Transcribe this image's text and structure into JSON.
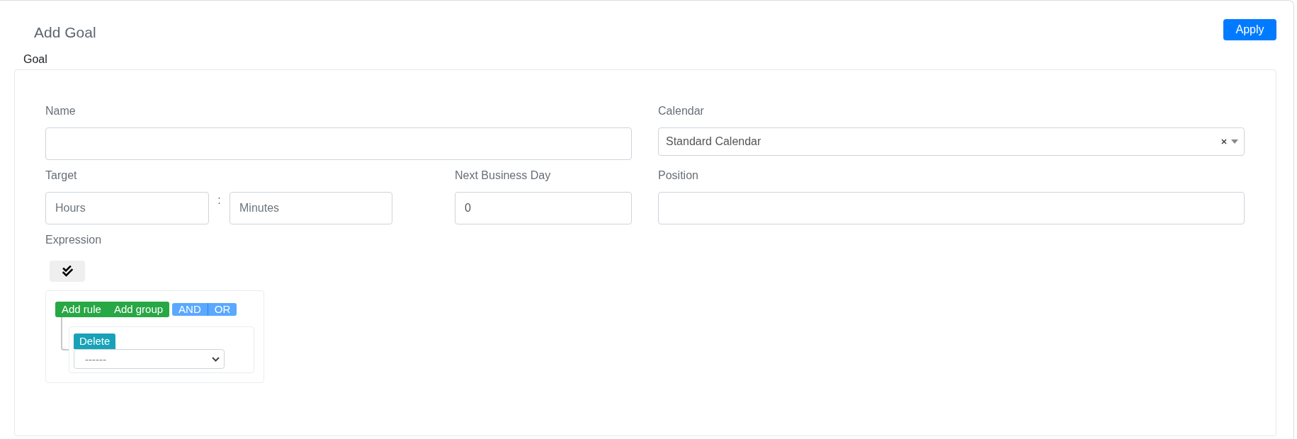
{
  "header": {
    "title": "Add Goal",
    "apply_button": "Apply"
  },
  "section_title": "Goal",
  "fields": {
    "name": {
      "label": "Name"
    },
    "calendar": {
      "label": "Calendar",
      "value": "Standard Calendar"
    },
    "target": {
      "label": "Target",
      "hours": {
        "placeholder": "Hours"
      },
      "separator": ":",
      "minutes": {
        "placeholder": "Minutes"
      }
    },
    "next_business_day": {
      "label": "Next Business Day",
      "value": "0"
    },
    "position": {
      "label": "Position"
    }
  },
  "expression": {
    "label": "Expression",
    "query_builder": {
      "actions": [
        {
          "label": "Add rule"
        },
        {
          "label": "Add group"
        }
      ],
      "conjunctions": [
        {
          "label": "AND",
          "selected": false
        },
        {
          "label": "OR",
          "selected": false
        }
      ],
      "rules": [
        {
          "delete_button": "Delete",
          "field": {
            "placeholder": "------"
          }
        }
      ]
    }
  }
}
